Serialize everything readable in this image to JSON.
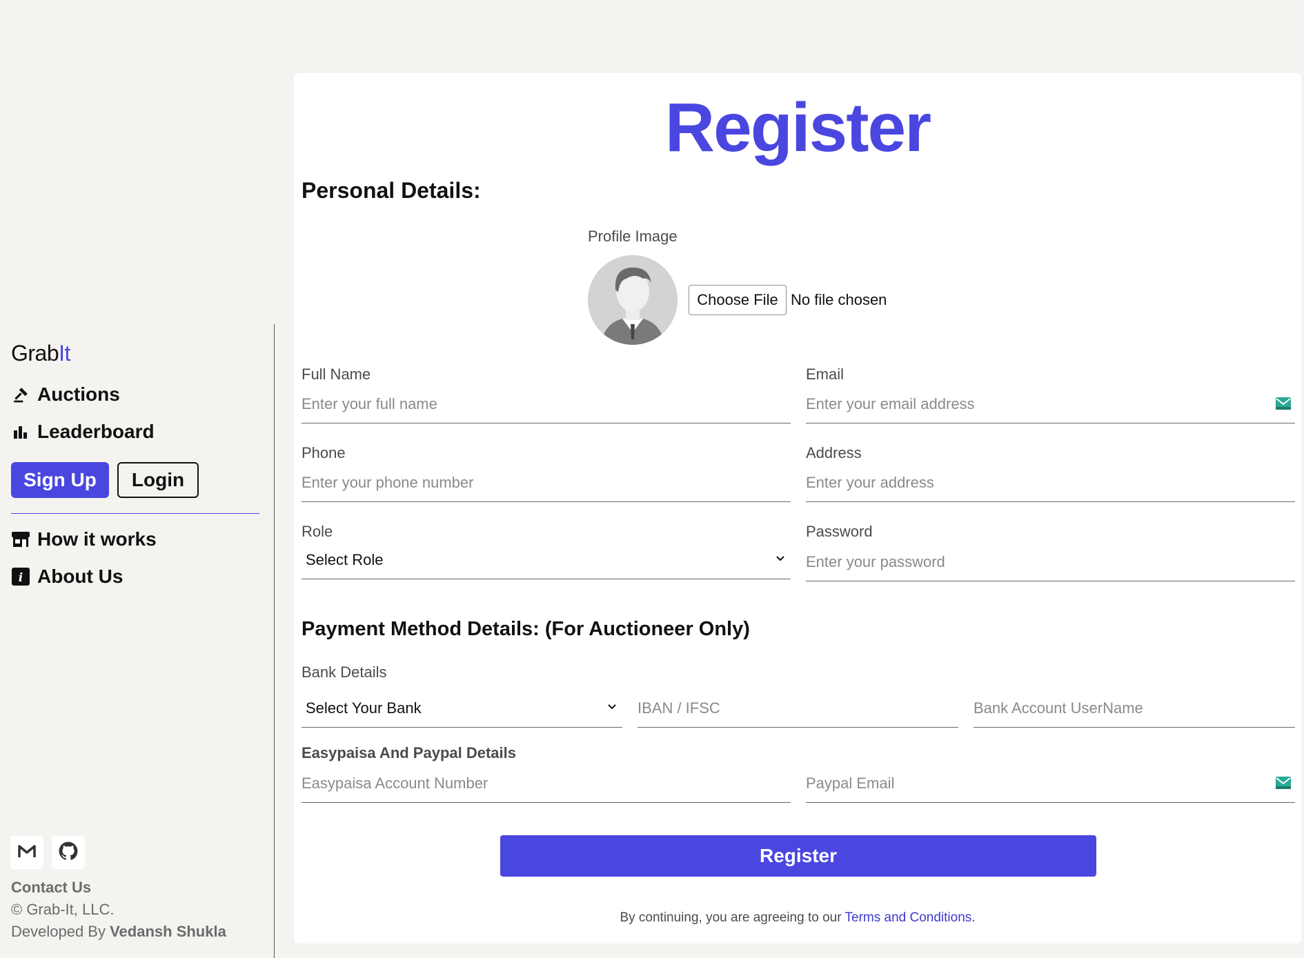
{
  "sidebar": {
    "brand_prefix": "Grab",
    "brand_suffix": "It",
    "nav": {
      "auctions": "Auctions",
      "leaderboard": "Leaderboard",
      "how_it_works": "How it works",
      "about_us": "About Us"
    },
    "signup_label": "Sign Up",
    "login_label": "Login",
    "footer": {
      "contact": "Contact Us",
      "copyright": "© Grab-It, LLC.",
      "developed_prefix": "Developed By ",
      "developer": "Vedansh Shukla"
    }
  },
  "form": {
    "title": "Register",
    "personal_heading": "Personal Details:",
    "profile_label": "Profile Image",
    "choose_file": "Choose File",
    "file_status": "No file chosen",
    "full_name": {
      "label": "Full Name",
      "placeholder": "Enter your full name"
    },
    "email": {
      "label": "Email",
      "placeholder": "Enter your email address"
    },
    "phone": {
      "label": "Phone",
      "placeholder": "Enter your phone number"
    },
    "address": {
      "label": "Address",
      "placeholder": "Enter your address"
    },
    "role": {
      "label": "Role",
      "selected": "Select Role"
    },
    "password": {
      "label": "Password",
      "placeholder": "Enter your password"
    },
    "payment_heading": "Payment Method Details: (For Auctioneer Only)",
    "bank_label": "Bank Details",
    "bank_select": "Select Your Bank",
    "iban_placeholder": "IBAN / IFSC",
    "bank_user_placeholder": "Bank Account UserName",
    "easypaisa_heading": "Easypaisa And Paypal Details",
    "easypaisa_placeholder": "Easypaisa Account Number",
    "paypal_placeholder": "Paypal Email",
    "submit_label": "Register",
    "terms_prefix": "By continuing, you are agreeing to our ",
    "terms_link": "Terms and Conditions",
    "terms_suffix": "."
  },
  "colors": {
    "accent": "#4a46e0",
    "background": "#f4f3f0",
    "mail_icon": "#2aa893"
  },
  "icons": [
    "gavel-icon",
    "bar-chart-icon",
    "store-icon",
    "info-icon",
    "gmail-icon",
    "github-icon",
    "mail-icon",
    "chevron-down-icon",
    "avatar-placeholder"
  ]
}
